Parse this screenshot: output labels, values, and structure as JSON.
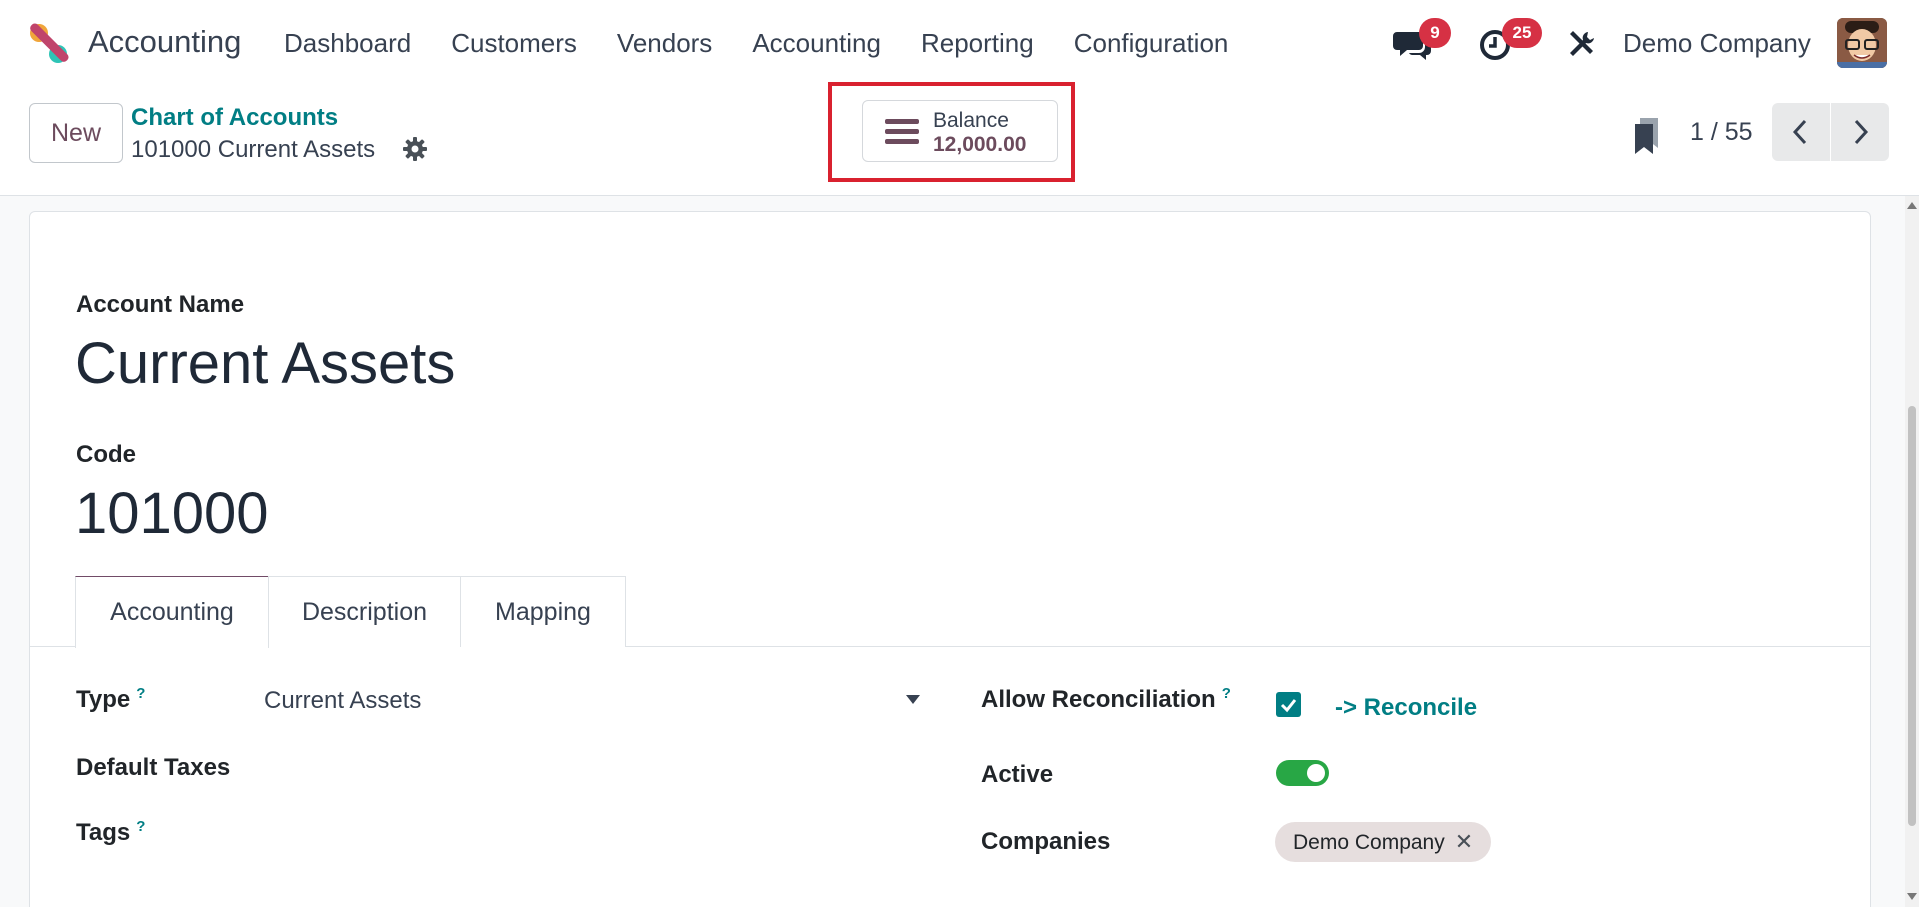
{
  "app": {
    "name": "Accounting",
    "logo_icon": "odoo-accounting-logo-icon"
  },
  "menu": [
    {
      "label": "Dashboard"
    },
    {
      "label": "Customers"
    },
    {
      "label": "Vendors"
    },
    {
      "label": "Accounting"
    },
    {
      "label": "Reporting"
    },
    {
      "label": "Configuration"
    }
  ],
  "systray": {
    "messages_count": "9",
    "activities_count": "25",
    "company": "Demo Company",
    "avatar_icon": "user-avatar-icon"
  },
  "control_panel": {
    "new_label": "New",
    "breadcrumb_parent": "Chart of Accounts",
    "record_title": "101000 Current Assets",
    "smart_button": {
      "label": "Balance",
      "value": "12,000.00",
      "icon": "list-bars-icon"
    },
    "pager": "1 / 55"
  },
  "form": {
    "account_name_label": "Account Name",
    "account_name": "Current Assets",
    "code_label": "Code",
    "code": "101000",
    "tabs": [
      {
        "label": "Accounting",
        "active": true
      },
      {
        "label": "Description",
        "active": false
      },
      {
        "label": "Mapping",
        "active": false
      }
    ],
    "fields": {
      "type_label": "Type",
      "type_value": "Current Assets",
      "default_taxes_label": "Default Taxes",
      "tags_label": "Tags",
      "allow_reconciliation_label": "Allow Reconciliation",
      "allow_reconciliation": true,
      "reconcile_link": "-> Reconcile",
      "active_label": "Active",
      "active": true,
      "companies_label": "Companies",
      "companies": [
        "Demo Company"
      ]
    },
    "help_marker": "?"
  },
  "colors": {
    "brand_purple": "#714b67",
    "teal": "#017e84",
    "badge_red": "#d63144",
    "toggle_green": "#28a745",
    "highlight_red": "#d9212f"
  }
}
